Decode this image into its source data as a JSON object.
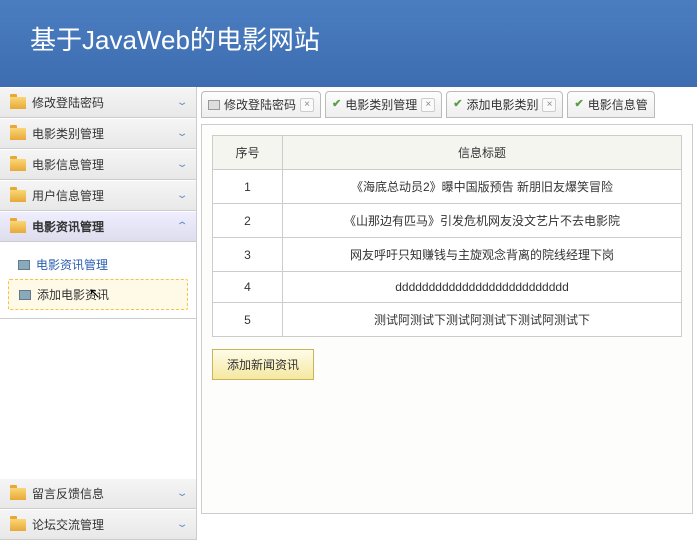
{
  "header": {
    "title": "基于JavaWeb的电影网站"
  },
  "sidebar": {
    "items": [
      {
        "label": "修改登陆密码"
      },
      {
        "label": "电影类别管理"
      },
      {
        "label": "电影信息管理"
      },
      {
        "label": "用户信息管理"
      },
      {
        "label": "电影资讯管理"
      },
      {
        "label": "留言反馈信息"
      },
      {
        "label": "论坛交流管理"
      }
    ],
    "submenu": [
      {
        "label": "电影资讯管理"
      },
      {
        "label": "添加电影资讯"
      }
    ]
  },
  "tabs": [
    {
      "label": "修改登陆密码",
      "icon": "doc"
    },
    {
      "label": "电影类别管理",
      "icon": "check"
    },
    {
      "label": "添加电影类别",
      "icon": "check"
    },
    {
      "label": "电影信息管"
    }
  ],
  "table": {
    "headers": [
      "序号",
      "信息标题"
    ],
    "rows": [
      [
        "1",
        "《海底总动员2》曝中国版预告 新朋旧友爆笑冒险"
      ],
      [
        "2",
        "《山那边有匹马》引发危机网友没文艺片不去电影院"
      ],
      [
        "3",
        "网友呼吁只知赚钱与主旋观念背离的院线经理下岗"
      ],
      [
        "4",
        "dddddddddddddddddddddddddd"
      ],
      [
        "5",
        "测试阿测试下测试阿测试下测试阿测试下"
      ]
    ]
  },
  "buttons": {
    "add_news": "添加新闻资讯"
  }
}
